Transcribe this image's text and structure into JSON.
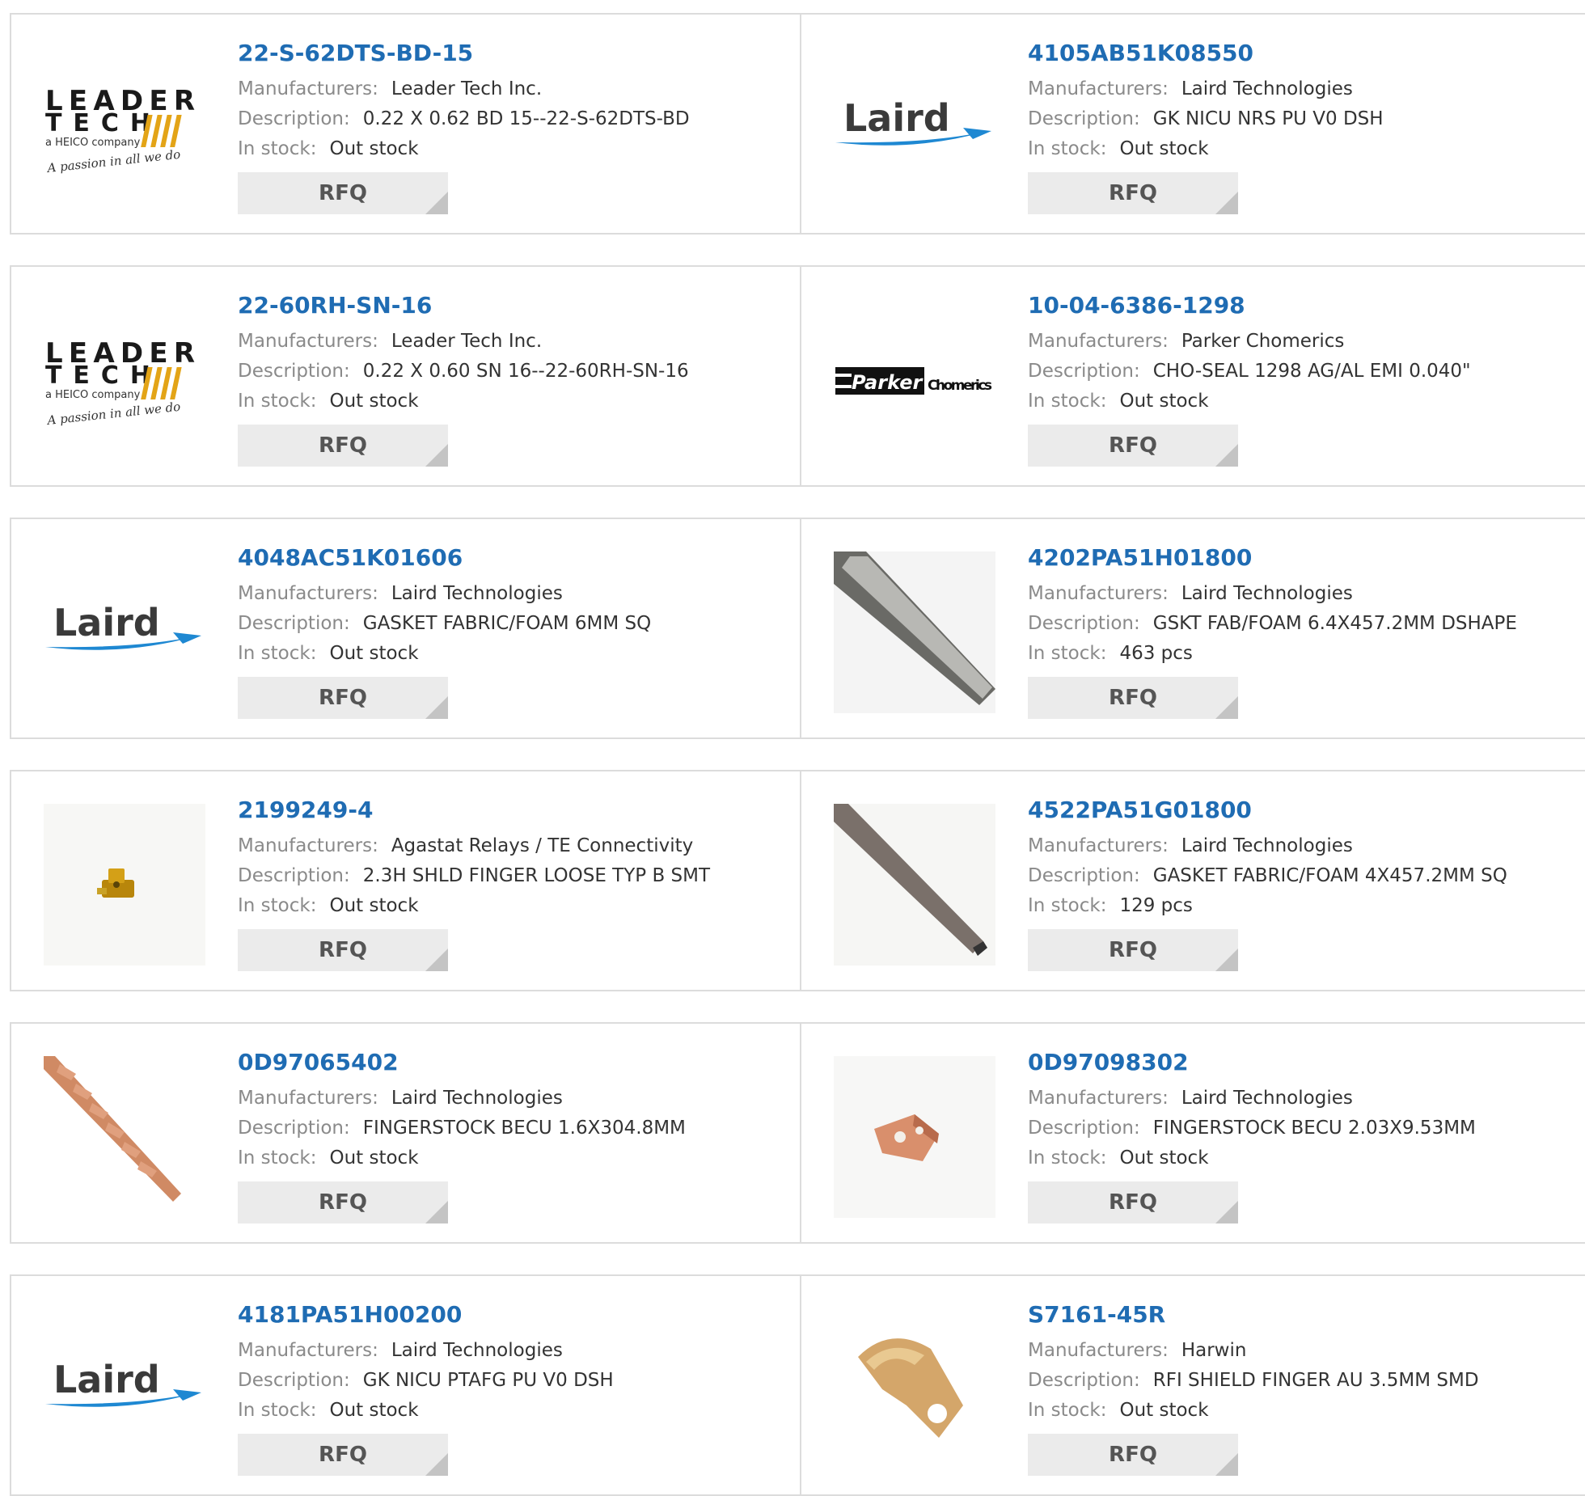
{
  "products": [
    {
      "part": "22-S-62DTS-BD-15",
      "mfr_label": "Manufacturers:",
      "mfr": "Leader Tech Inc.",
      "desc_label": "Description:",
      "desc": "0.22 X 0.62 BD 15--22-S-62DTS-BD",
      "stock_label": "In stock:",
      "stock": "Out stock",
      "rfq": "RFQ",
      "image": "leader-tech-logo",
      "logo_text": {
        "line1": "LEADER",
        "line2": "TECH",
        "tagline": "a HEICO company",
        "slogan": "A passion in all we do"
      }
    },
    {
      "part": "4105AB51K08550",
      "mfr_label": "Manufacturers:",
      "mfr": "Laird Technologies",
      "desc_label": "Description:",
      "desc": "GK NICU NRS PU V0 DSH",
      "stock_label": "In stock:",
      "stock": "Out stock",
      "rfq": "RFQ",
      "image": "laird-logo",
      "logo_text": {
        "word": "Laird"
      }
    },
    {
      "part": "22-60RH-SN-16",
      "mfr_label": "Manufacturers:",
      "mfr": "Leader Tech Inc.",
      "desc_label": "Description:",
      "desc": "0.22 X 0.60 SN 16--22-60RH-SN-16",
      "stock_label": "In stock:",
      "stock": "Out stock",
      "rfq": "RFQ",
      "image": "leader-tech-logo",
      "logo_text": {
        "line1": "LEADER",
        "line2": "TECH",
        "tagline": "a HEICO company",
        "slogan": "A passion in all we do"
      }
    },
    {
      "part": "10-04-6386-1298",
      "mfr_label": "Manufacturers:",
      "mfr": "Parker Chomerics",
      "desc_label": "Description:",
      "desc": "CHO-SEAL 1298 AG/AL EMI 0.040\"",
      "stock_label": "In stock:",
      "stock": "Out stock",
      "rfq": "RFQ",
      "image": "parker-chomerics-logo",
      "logo_text": {
        "brand": "Parker",
        "sub": "Chomerics"
      }
    },
    {
      "part": "4048AC51K01606",
      "mfr_label": "Manufacturers:",
      "mfr": "Laird Technologies",
      "desc_label": "Description:",
      "desc": "GASKET FABRIC/FOAM 6MM SQ",
      "stock_label": "In stock:",
      "stock": "Out stock",
      "rfq": "RFQ",
      "image": "laird-logo",
      "logo_text": {
        "word": "Laird"
      }
    },
    {
      "part": "4202PA51H01800",
      "mfr_label": "Manufacturers:",
      "mfr": "Laird Technologies",
      "desc_label": "Description:",
      "desc": "GSKT FAB/FOAM 6.4X457.2MM DSHAPE",
      "stock_label": "In stock:",
      "stock": "463 pcs",
      "rfq": "RFQ",
      "image": "gasket-strip-grey-photo"
    },
    {
      "part": "2199249-4",
      "mfr_label": "Manufacturers:",
      "mfr": "Agastat Relays / TE Connectivity",
      "desc_label": "Description:",
      "desc": "2.3H SHLD FINGER LOOSE TYP B SMT",
      "stock_label": "In stock:",
      "stock": "Out stock",
      "rfq": "RFQ",
      "image": "gold-finger-clip-photo"
    },
    {
      "part": "4522PA51G01800",
      "mfr_label": "Manufacturers:",
      "mfr": "Laird Technologies",
      "desc_label": "Description:",
      "desc": "GASKET FABRIC/FOAM 4X457.2MM SQ",
      "stock_label": "In stock:",
      "stock": "129 pcs",
      "rfq": "RFQ",
      "image": "gasket-strip-brown-photo"
    },
    {
      "part": "0D97065402",
      "mfr_label": "Manufacturers:",
      "mfr": "Laird Technologies",
      "desc_label": "Description:",
      "desc": "FINGERSTOCK BECU 1.6X304.8MM",
      "stock_label": "In stock:",
      "stock": "Out stock",
      "rfq": "RFQ",
      "image": "fingerstock-strip-photo"
    },
    {
      "part": "0D97098302",
      "mfr_label": "Manufacturers:",
      "mfr": "Laird Technologies",
      "desc_label": "Description:",
      "desc": "FINGERSTOCK BECU 2.03X9.53MM",
      "stock_label": "In stock:",
      "stock": "Out stock",
      "rfq": "RFQ",
      "image": "copper-clip-photo"
    },
    {
      "part": "4181PA51H00200",
      "mfr_label": "Manufacturers:",
      "mfr": "Laird Technologies",
      "desc_label": "Description:",
      "desc": "GK NICU PTAFG PU V0 DSH",
      "stock_label": "In stock:",
      "stock": "Out stock",
      "rfq": "RFQ",
      "image": "laird-logo",
      "logo_text": {
        "word": "Laird"
      }
    },
    {
      "part": "S7161-45R",
      "mfr_label": "Manufacturers:",
      "mfr": "Harwin",
      "desc_label": "Description:",
      "desc": "RFI SHIELD FINGER AU 3.5MM SMD",
      "stock_label": "In stock:",
      "stock": "Out stock",
      "rfq": "RFQ",
      "image": "gold-shield-finger-photo"
    }
  ],
  "colors": {
    "part_link": "#1f6cb3",
    "label": "#8a8a8a",
    "value": "#333333",
    "rfq_bg": "#ebebeb",
    "border": "#dcdcdc",
    "laird_swoosh": "#1e88d2"
  }
}
